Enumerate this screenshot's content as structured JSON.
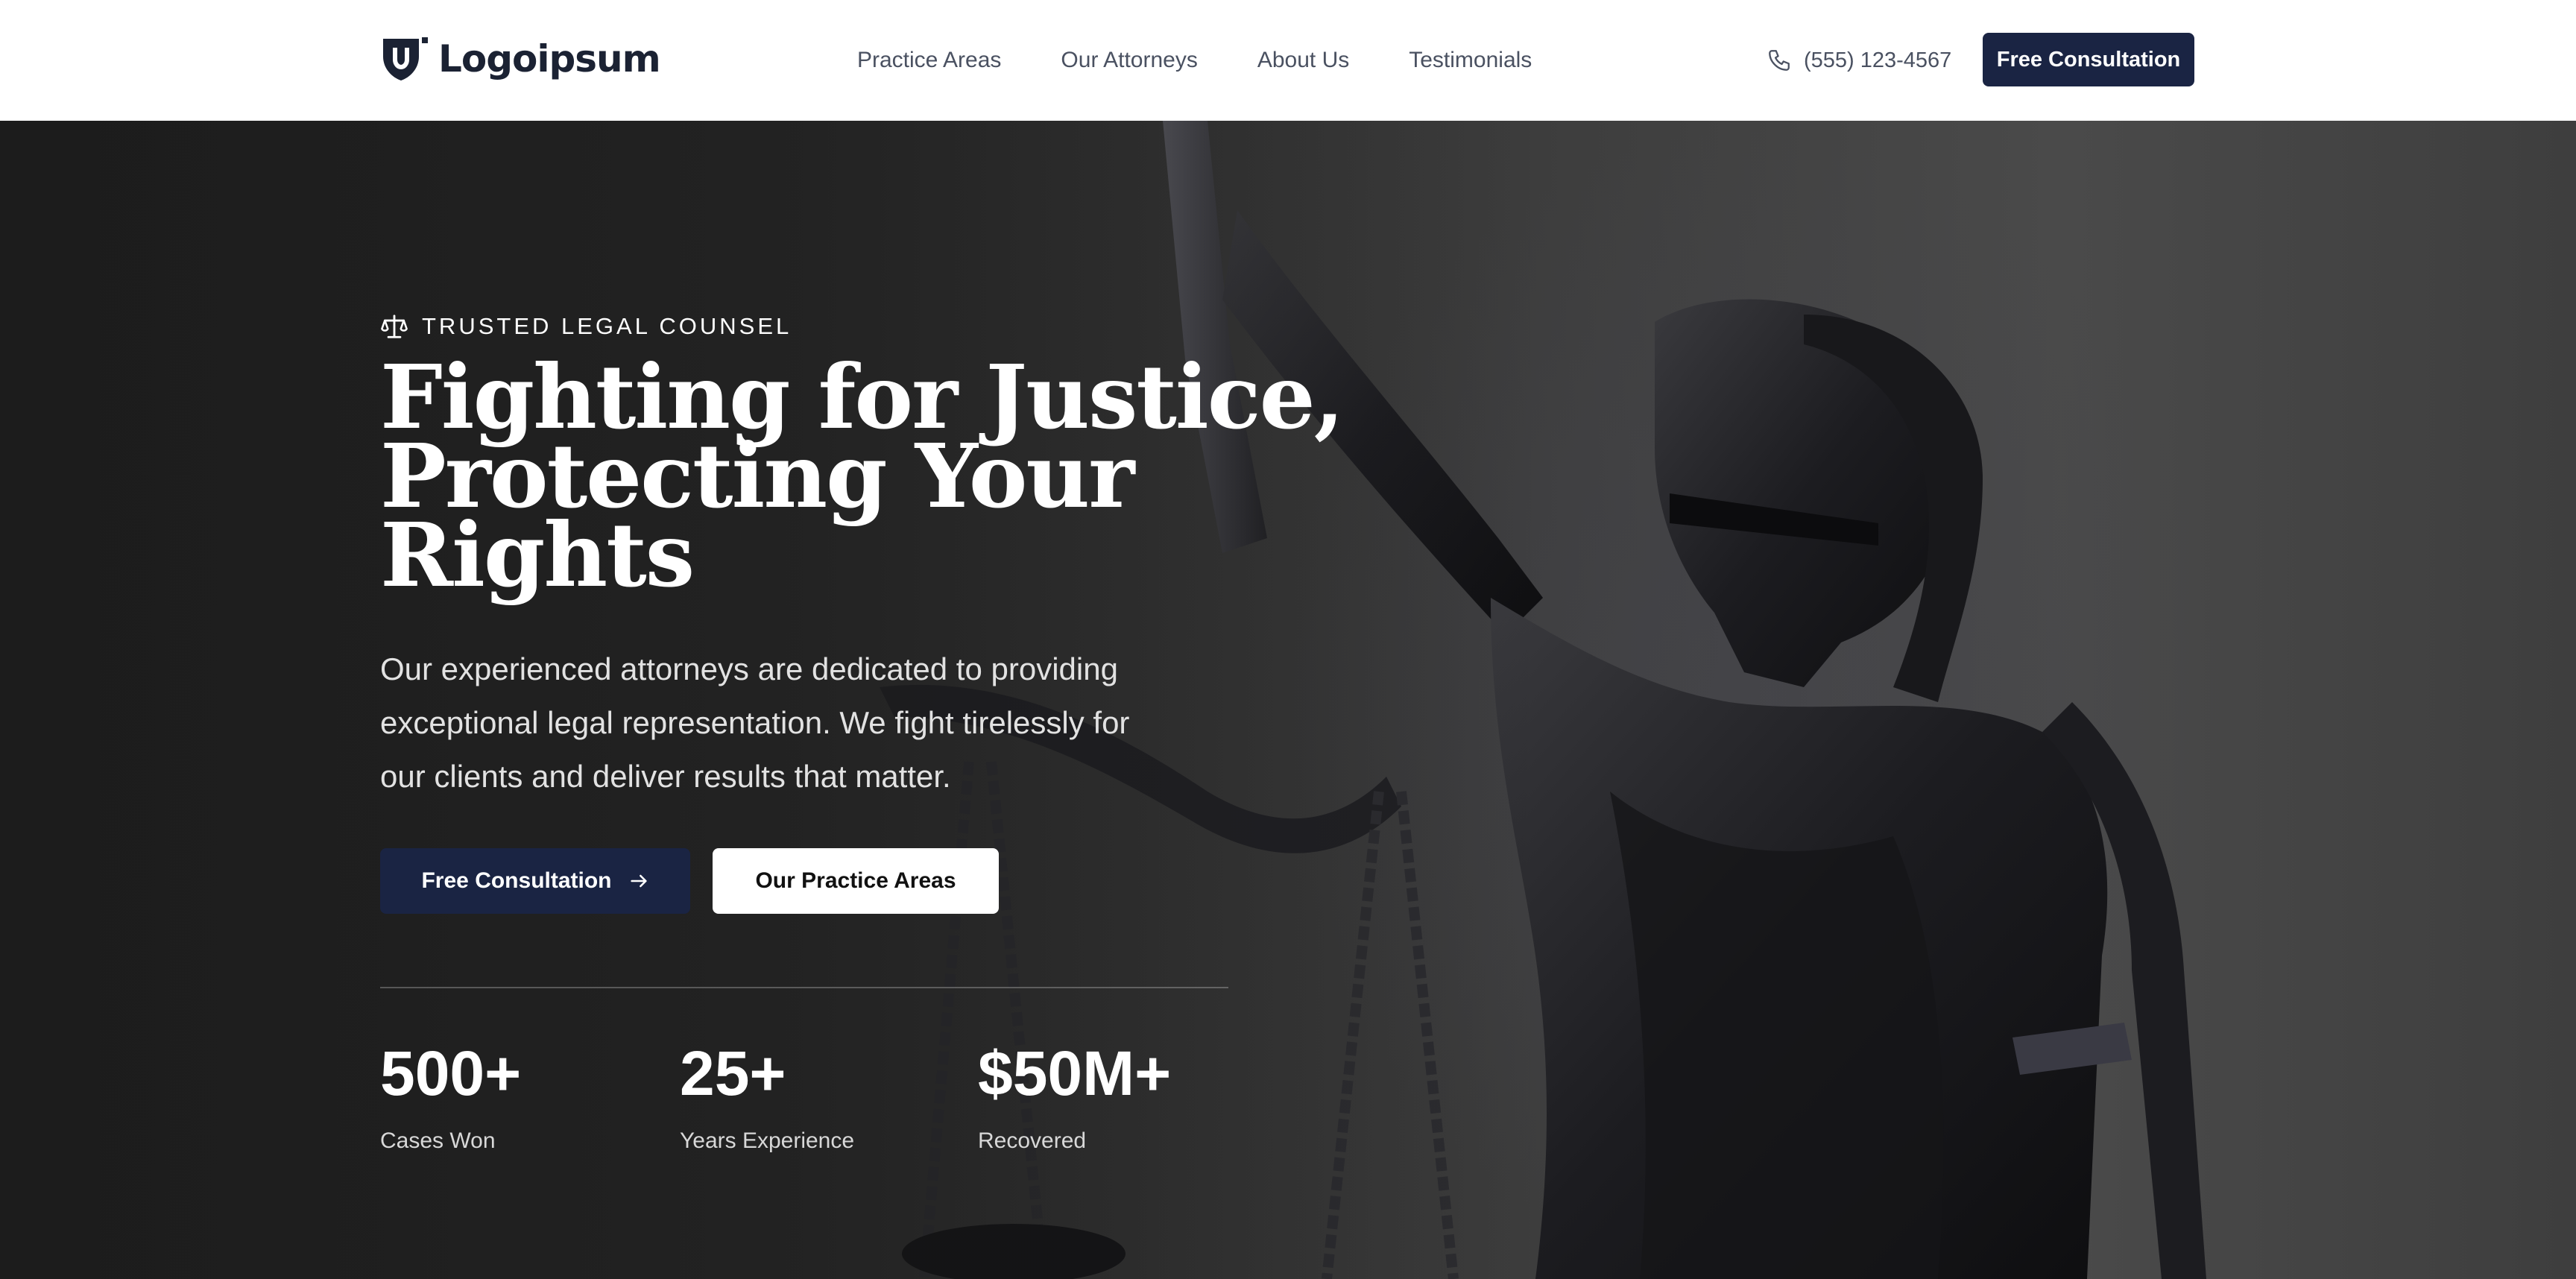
{
  "header": {
    "brand": "Logoipsum",
    "nav": [
      "Practice Areas",
      "Our Attorneys",
      "About Us",
      "Testimonials"
    ],
    "phone": "(555) 123-4567",
    "cta_label": "Free Consultation"
  },
  "hero": {
    "eyebrow": "TRUSTED LEGAL COUNSEL",
    "title_lines": [
      "Fighting for Justice,",
      "Protecting Your",
      "Rights"
    ],
    "description": "Our experienced attorneys are dedicated to providing exceptional legal representation. We fight tirelessly for our clients and deliver results that matter.",
    "primary_button": "Free Consultation",
    "secondary_button": "Our Practice Areas",
    "stats": [
      {
        "value": "500+",
        "label": "Cases Won"
      },
      {
        "value": "25+",
        "label": "Years Experience"
      },
      {
        "value": "$50M+",
        "label": "Recovered"
      }
    ]
  },
  "icons": {
    "logo": "shield-logo-icon",
    "phone": "phone-icon",
    "eyebrow": "scale-icon",
    "button_arrow": "arrow-right-icon"
  },
  "colors": {
    "brand_navy": "#1a2443",
    "header_bg": "#ffffff",
    "nav_text": "#4a5161",
    "hero_text": "#ffffff"
  }
}
